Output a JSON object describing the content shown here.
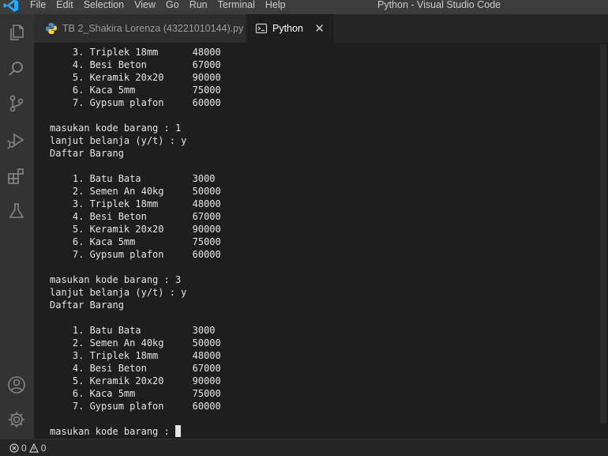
{
  "titlebar": {
    "menu": [
      "File",
      "Edit",
      "Selection",
      "View",
      "Go",
      "Run",
      "Terminal",
      "Help"
    ],
    "window_title": "Python - Visual Studio Code"
  },
  "activitybar": {
    "icons": [
      "explorer-icon",
      "search-icon",
      "source-control-icon",
      "run-debug-icon",
      "extensions-icon",
      "testing-icon",
      "account-icon",
      "settings-gear-icon"
    ]
  },
  "tabs": [
    {
      "label": "TB 2_Shakira Lorenza (43221010144).py",
      "active": false,
      "icon": "python-file-icon"
    },
    {
      "label": "Python",
      "active": true,
      "icon": "terminal-icon",
      "close": "✕"
    }
  ],
  "terminal": {
    "lines": [
      "    3. Triplek 18mm      48000",
      "    4. Besi Beton        67000",
      "    5. Keramik 20x20     90000",
      "    6. Kaca 5mm          75000",
      "    7. Gypsum plafon     60000",
      "",
      "masukan kode barang : 1",
      "lanjut belanja (y/t) : y",
      "Daftar Barang",
      "",
      "    1. Batu Bata         3000",
      "    2. Semen An 40kg     50000",
      "    3. Triplek 18mm      48000",
      "    4. Besi Beton        67000",
      "    5. Keramik 20x20     90000",
      "    6. Kaca 5mm          75000",
      "    7. Gypsum plafon     60000",
      "",
      "masukan kode barang : 3",
      "lanjut belanja (y/t) : y",
      "Daftar Barang",
      "",
      "    1. Batu Bata         3000",
      "    2. Semen An 40kg     50000",
      "    3. Triplek 18mm      48000",
      "    4. Besi Beton        67000",
      "    5. Keramik 20x20     90000",
      "    6. Kaca 5mm          75000",
      "    7. Gypsum plafon     60000",
      "",
      "masukan kode barang : "
    ]
  },
  "statusbar": {
    "errors": "0",
    "warnings": "0"
  },
  "colors": {
    "accent": "#007acc",
    "python_blue": "#3572a5",
    "editor_bg": "#1e1e1e",
    "activitybar_bg": "#333333"
  }
}
